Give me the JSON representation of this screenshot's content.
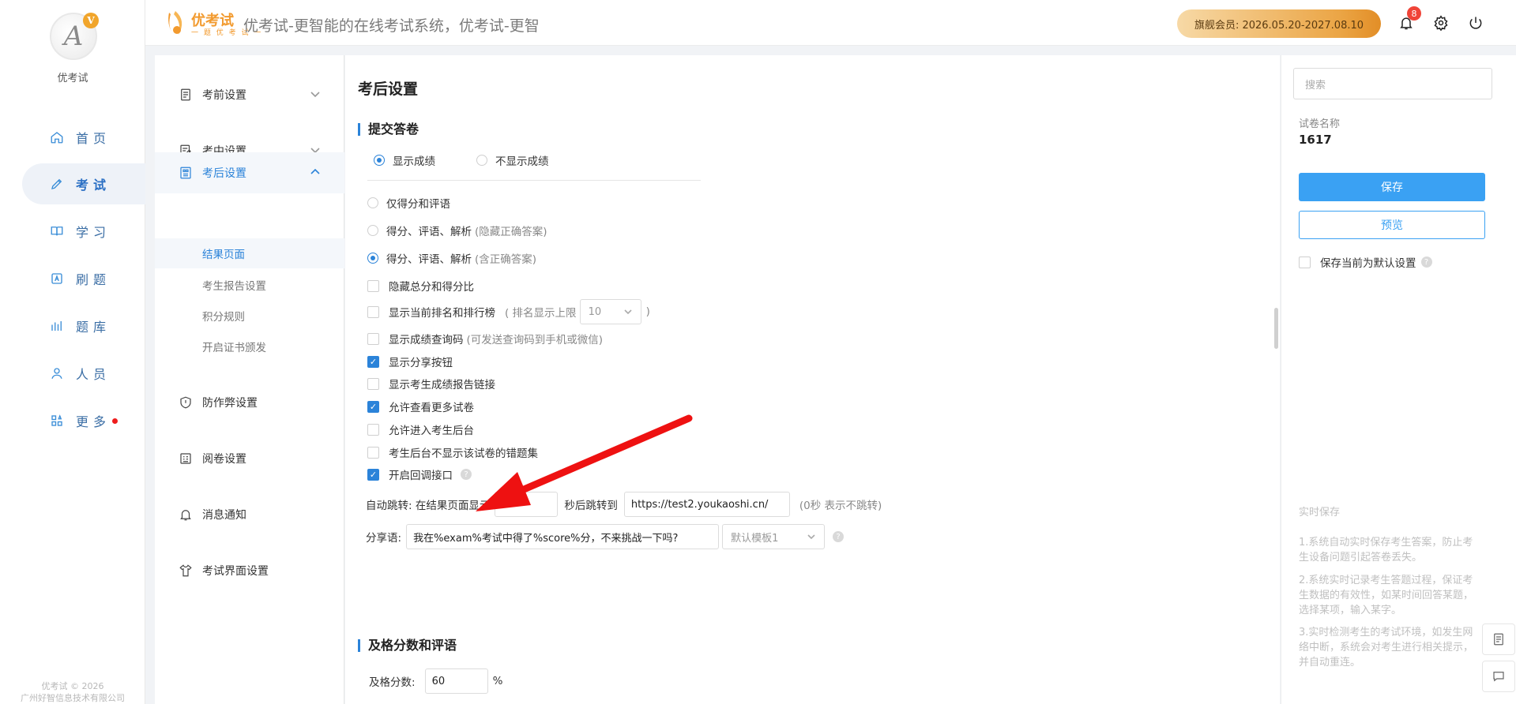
{
  "brand": {
    "name": "优考试",
    "footer_line1": "优考试 © 2026",
    "footer_line2": "广州好智信息技术有限公司"
  },
  "nav": [
    {
      "label": "首页",
      "icon": "home-icon"
    },
    {
      "label": "考试",
      "icon": "exam-icon",
      "active": true
    },
    {
      "label": "学习",
      "icon": "book-icon"
    },
    {
      "label": "刷题",
      "icon": "practice-icon"
    },
    {
      "label": "题库",
      "icon": "bank-icon"
    },
    {
      "label": "人员",
      "icon": "user-icon"
    },
    {
      "label": "更多",
      "icon": "more-icon",
      "dot": true
    }
  ],
  "header": {
    "logo_text": "优考试",
    "logo_sub": "一 题 优 考 试 一",
    "title": "优考试-更智能的在线考试系统，优考试-更智",
    "vip": "旗舰会员:  2026.05.20-2027.08.10",
    "notification_count": "8"
  },
  "settings_menu": {
    "items": [
      {
        "label": "考前设置",
        "icon": "pre-exam-icon"
      },
      {
        "label": "考中设置",
        "icon": "in-exam-icon"
      },
      {
        "label": "考后设置",
        "icon": "post-exam-icon",
        "open": true
      },
      {
        "label": "防作弊设置",
        "icon": "shield-icon"
      },
      {
        "label": "阅卷设置",
        "icon": "grading-icon"
      },
      {
        "label": "消息通知",
        "icon": "bell-icon"
      },
      {
        "label": "考试界面设置",
        "icon": "shirt-icon"
      }
    ],
    "sub_items": [
      "结果页面",
      "考生报告设置",
      "积分规则",
      "开启证书颁发"
    ]
  },
  "main": {
    "page_title": "考后设置",
    "submit_section": "提交答卷",
    "score_display": {
      "show": "显示成绩",
      "hide": "不显示成绩"
    },
    "result_options": [
      {
        "label": "仅得分和评语",
        "hint": "",
        "selected": false
      },
      {
        "label": "得分、评语、解析",
        "hint": "(隐藏正确答案)",
        "selected": false
      },
      {
        "label": "得分、评语、解析",
        "hint": "(含正确答案)",
        "selected": true
      }
    ],
    "checkboxes": [
      {
        "label": "隐藏总分和得分比",
        "checked": false
      },
      {
        "label": "显示当前排名和排行榜",
        "checked": false
      },
      {
        "label": "显示成绩查询码",
        "hint": "(可发送查询码到手机或微信)",
        "checked": false
      },
      {
        "label": "显示分享按钮",
        "checked": true
      },
      {
        "label": "显示考生成绩报告链接",
        "checked": false
      },
      {
        "label": "允许查看更多试卷",
        "checked": true
      },
      {
        "label": "允许进入考生后台",
        "checked": false
      },
      {
        "label": "考生后台不显示该试卷的错题集",
        "checked": false
      },
      {
        "label": "开启回调接口",
        "checked": true
      }
    ],
    "rank_limit": {
      "prefix": "( 排名显示上限",
      "value": "10",
      "suffix": ")"
    },
    "auto_jump": {
      "label": "自动跳转: 在结果页面显示",
      "seconds": "0",
      "mid": "秒后跳转到",
      "url": "https://test2.youkaoshi.cn/",
      "hint": "(0秒 表示不跳转)"
    },
    "share": {
      "label": "分享语:",
      "text": "我在%exam%考试中得了%score%分，不来挑战一下吗?",
      "template": "默认模板1"
    },
    "pass_section": "及格分数和评语",
    "pass": {
      "label": "及格分数:",
      "value": "60",
      "unit": "%"
    }
  },
  "right": {
    "search_placeholder": "搜索",
    "paper_label": "试卷名称",
    "paper_value": "1617",
    "save": "保存",
    "preview": "预览",
    "default_label": "保存当前为默认设置",
    "realtime_title": "实时保存",
    "notes": [
      "1.系统自动实时保存考生答案，防止考生设备问题引起答卷丢失。",
      "2.系统实时记录考生答题过程，保证考生数据的有效性，如某时间回答某题，选择某项，输入某字。",
      "3.实时检测考生的考试环境，如发生网络中断，系统会对考生进行相关提示，并自动重连。"
    ]
  },
  "colors": {
    "accent": "#2b83d9",
    "save_button": "#3aa1f3",
    "vip_gradient_end": "#e28e27",
    "arrow": "#ee1111"
  }
}
